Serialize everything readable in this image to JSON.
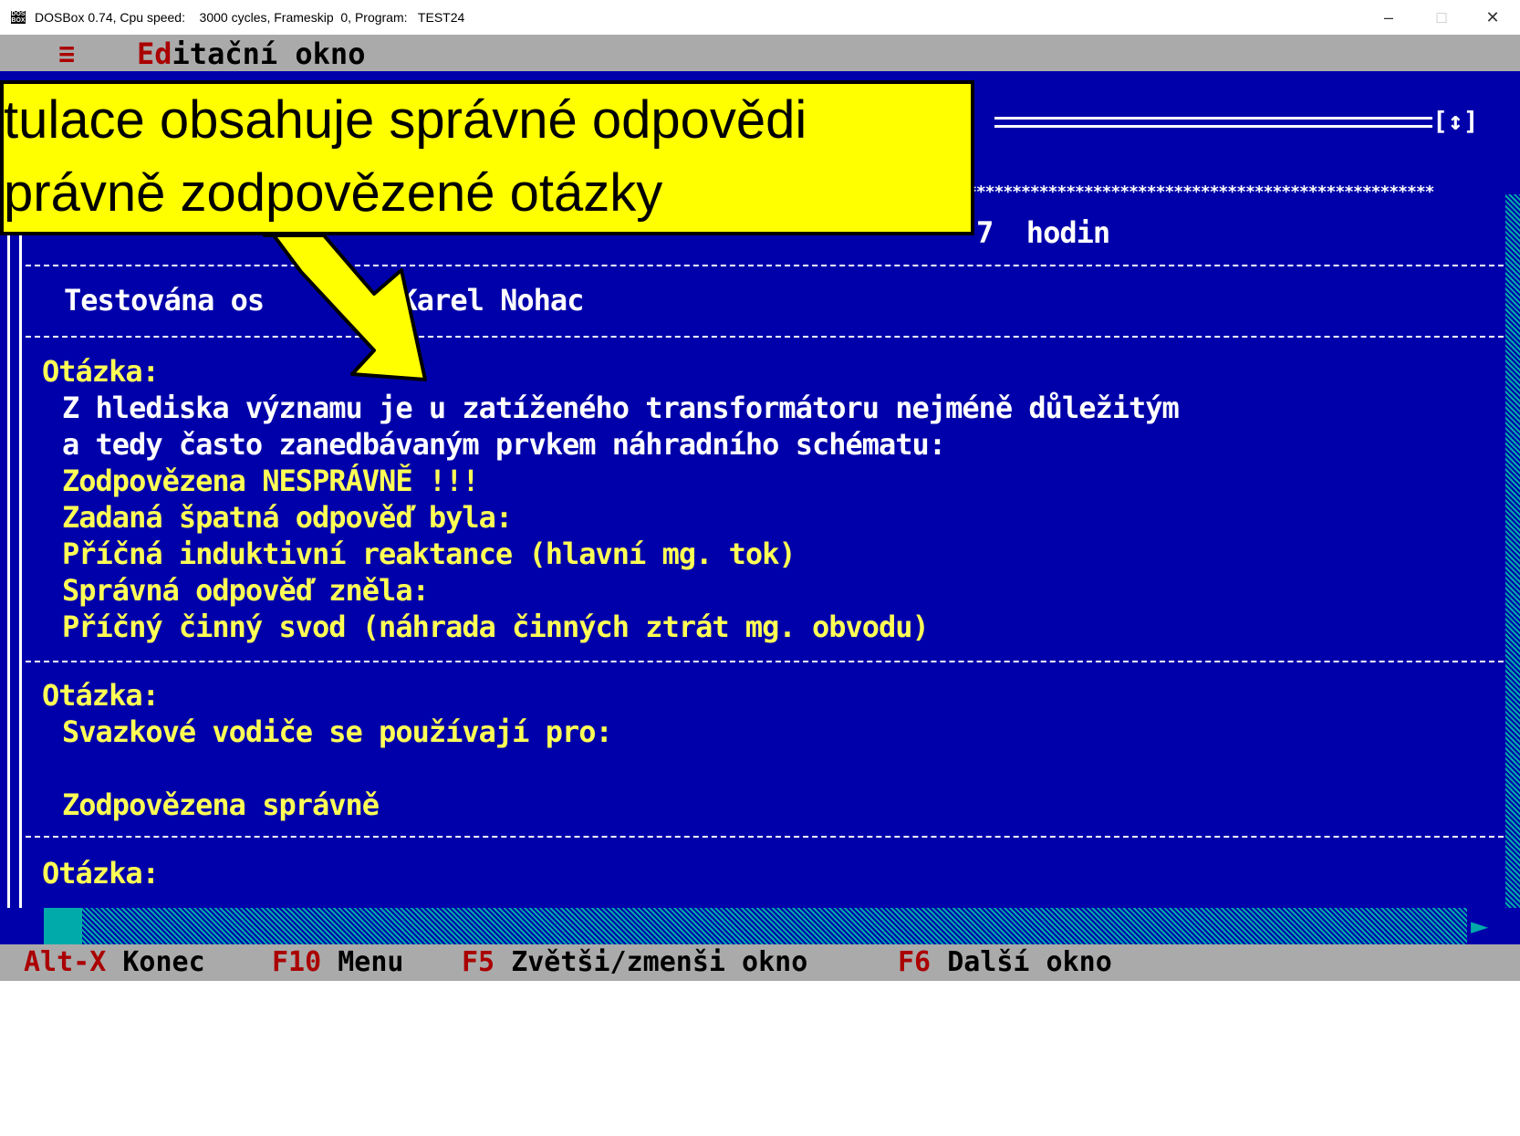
{
  "titlebar": {
    "text": "DOSBox 0.74, Cpu speed:    3000 cycles, Frameskip  0, Program:   TEST24",
    "minimize": "–",
    "maximize": "□",
    "close": "✕"
  },
  "menubar": {
    "menu_icon": "≡",
    "title_hot": "Ed",
    "title_rest": "itační okno"
  },
  "window": {
    "frame_marker": "[↕]",
    "stars": "****************************************************",
    "time_tail": "7  hodin",
    "person_label": "Testována os",
    "person_value": ": Karel Nohac",
    "q1_label": "Otázka:",
    "q1_line1": "Z hlediska významu je u zatíženého transformátoru nejméně důležitým",
    "q1_line2": "a tedy často zanedbávaným prvkem náhradního schématu:",
    "q1_status": "Zodpovězena NESPRÁVNĚ !!!",
    "q1_wrong_label": "Zadaná špatná odpověď byla:",
    "q1_wrong_answer": "Příčná induktivní reaktance (hlavní mg. tok)",
    "q1_correct_label": "Správná odpověď zněla:",
    "q1_correct_answer": "Příčný činný svod (náhrada činných ztrát mg. obvodu)",
    "q2_label": "Otázka:",
    "q2_line1": "Svazkové vodiče se používají pro:",
    "q2_status": "Zodpovězena správně",
    "q3_label": "Otázka:"
  },
  "statusbar": {
    "items": [
      {
        "key": "Alt-X",
        "label": "Konec"
      },
      {
        "key": "F10",
        "label": "Menu"
      },
      {
        "key": "F5",
        "label": "Zvětši/zmenši okno"
      },
      {
        "key": "F6",
        "label": "Další okno"
      }
    ]
  },
  "callout": {
    "line1": "tulace obsahuje správné odpovědi",
    "line2": "právně zodpovězené otázky"
  },
  "colors": {
    "dos_blue": "#0000aa",
    "dos_yellow": "#ffff55",
    "dos_gray": "#aaaaaa",
    "dos_red": "#aa0000",
    "callout_yellow": "#ffff00"
  }
}
